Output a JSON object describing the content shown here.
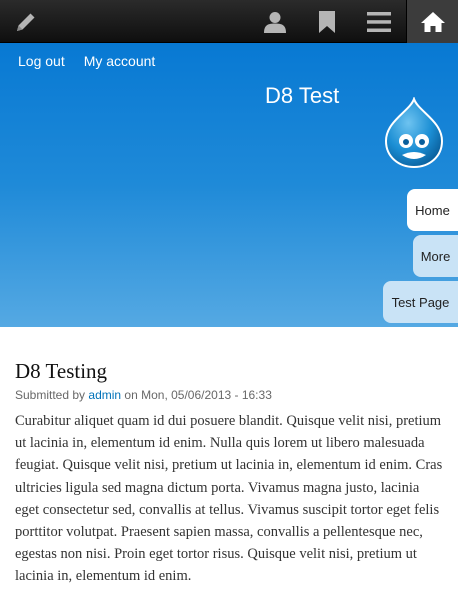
{
  "toolbar": {
    "items": [
      {
        "name": "edit",
        "icon": "pencil-icon"
      },
      {
        "name": "user",
        "icon": "user-icon"
      },
      {
        "name": "shortcuts",
        "icon": "bookmark-icon"
      },
      {
        "name": "menu",
        "icon": "hamburger-icon"
      },
      {
        "name": "home",
        "icon": "home-icon"
      }
    ],
    "icon_color": "#b5b5b5",
    "active_icon_color": "#ffffff"
  },
  "header": {
    "secondary_nav": {
      "logout": "Log out",
      "account": "My account"
    },
    "site_name": "D8 Test",
    "logo": "drupal-drop-logo",
    "main_nav": {
      "home": "Home",
      "more": "More",
      "test_page": "Test Page"
    },
    "colors": {
      "top": "#0879d3",
      "bottom": "#55a9e3",
      "active_tab": "#ffffff",
      "tab": "#c9e3f6"
    }
  },
  "node": {
    "title": "D8 Testing",
    "submitted_prefix": "Submitted by",
    "author": "admin",
    "submitted_on": "on Mon, 05/06/2013 - 16:33",
    "body": "Curabitur aliquet quam id dui posuere blandit. Quisque velit nisi, pretium ut lacinia in, elementum id enim. Nulla quis lorem ut libero malesuada feugiat. Quisque velit nisi, pretium ut lacinia in, elementum id enim. Cras ultricies ligula sed magna dictum porta. Vivamus magna justo, lacinia eget consectetur sed, convallis at tellus. Vivamus suscipit tortor eget felis porttitor volutpat. Praesent sapien massa, convallis a pellentesque nec, egestas non nisi. Proin eget tortor risus. Quisque velit nisi, pretium ut lacinia in, elementum id enim.",
    "link_color": "#0072b9"
  }
}
